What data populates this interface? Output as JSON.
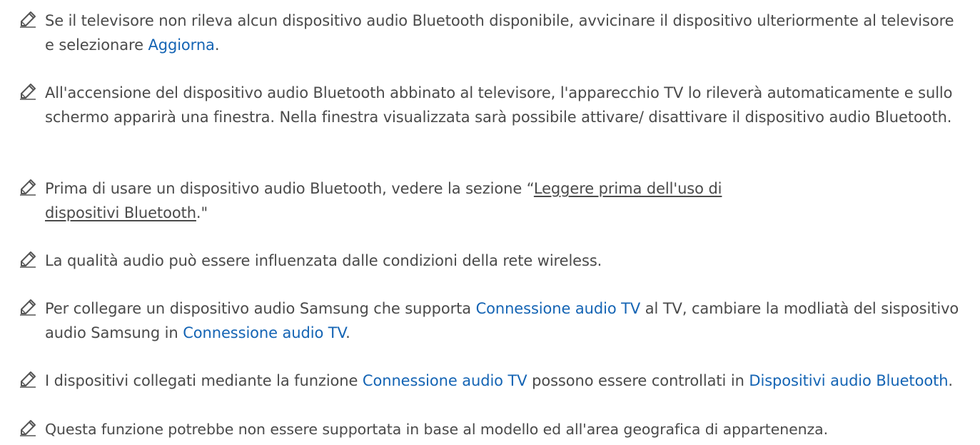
{
  "colors": {
    "text": "#4a4a4a",
    "highlight": "#1464b4",
    "icon": "#555555"
  },
  "notes": [
    {
      "icon": "pencil-icon",
      "p1": "Se il televisore non rileva alcun dispositivo audio Bluetooth disponibile, avvicinare il dispositivo ulteriormente al televisore e selezionare ",
      "h1": "Aggiorna",
      "p2": "."
    },
    {
      "icon": "pencil-icon",
      "p1": "All'accensione del dispositivo audio Bluetooth abbinato al televisore, l'apparecchio TV lo rileverà automaticamente e sullo schermo apparirà una finestra. Nella finestra visualizzata sarà possibile attivare/ disattivare il dispositivo audio Bluetooth."
    },
    {
      "icon": "pencil-icon",
      "p1": "Prima di usare un dispositivo audio Bluetooth, vedere la sezione “",
      "link": "Leggere prima dell'uso di dispositivi Bluetooth",
      "p2": ".\""
    },
    {
      "icon": "pencil-icon",
      "p1": "La qualità audio può essere influenzata dalle condizioni della rete wireless."
    },
    {
      "icon": "pencil-icon",
      "p1": "Per collegare un dispositivo audio Samsung che supporta ",
      "h1": "Connessione audio TV",
      "p2": " al TV, cambiare la modliatà del sispositivo audio Samsung in ",
      "h2": "Connessione audio TV",
      "p3": "."
    },
    {
      "icon": "pencil-icon",
      "p1": "I dispositivi collegati mediante la funzione ",
      "h1": "Connessione audio TV",
      "p2": " possono essere controllati in ",
      "h2": "Dispositivi audio Bluetooth",
      "p3": "."
    },
    {
      "icon": "pencil-icon",
      "p1": "Questa funzione potrebbe non essere supportata in base al modello ed all'area geografica di appartenenza."
    }
  ]
}
